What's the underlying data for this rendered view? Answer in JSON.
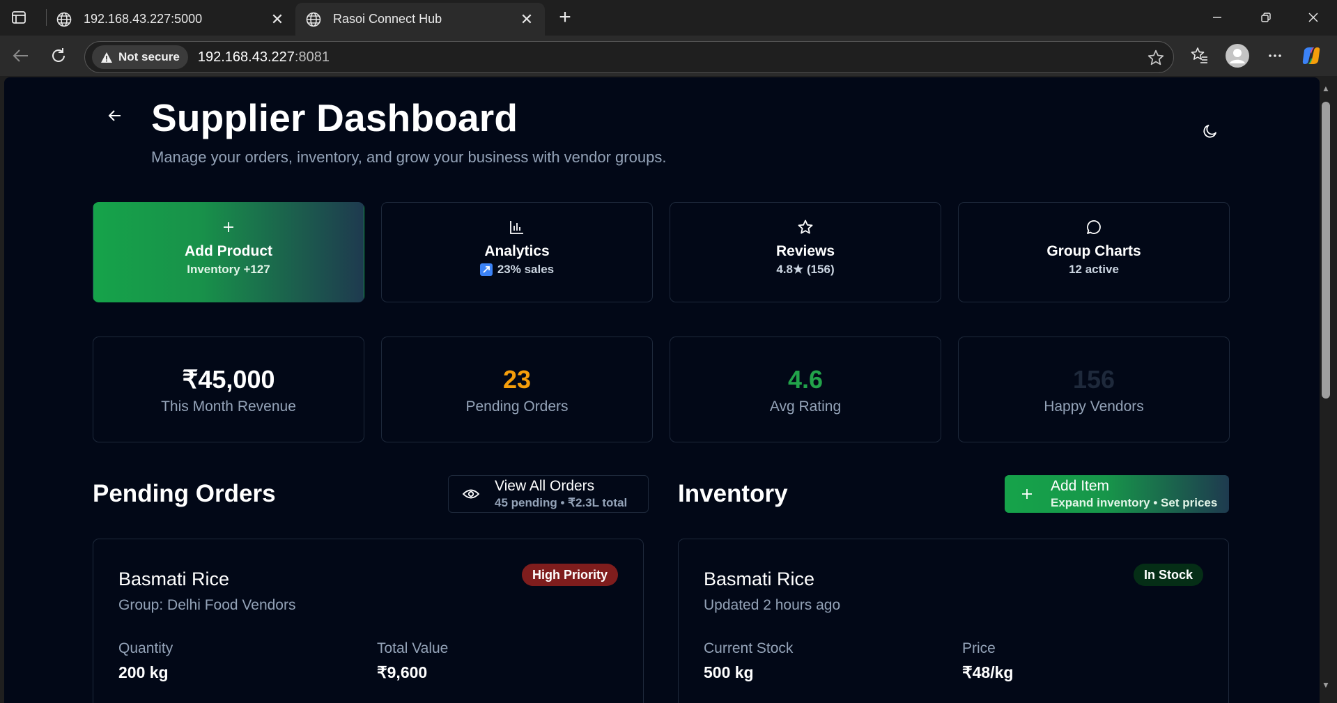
{
  "browser": {
    "tabs": [
      {
        "title": "192.168.43.227:5000",
        "active": false
      },
      {
        "title": "Rasoi Connect Hub",
        "active": true
      }
    ],
    "security_label": "Not secure",
    "url_host": "192.168.43.227",
    "url_port": ":8081"
  },
  "header": {
    "title": "Supplier Dashboard",
    "subtitle": "Manage your orders, inventory, and grow your business with vendor groups."
  },
  "quick_actions": [
    {
      "title": "Add Product",
      "subtitle": "Inventory +127",
      "icon": "plus-icon"
    },
    {
      "title": "Analytics",
      "subtitle": "23% sales",
      "icon": "bar-chart-icon"
    },
    {
      "title": "Reviews",
      "subtitle": "4.8★ (156)",
      "icon": "star-icon"
    },
    {
      "title": "Group Charts",
      "subtitle": "12 active",
      "icon": "message-circle-icon"
    }
  ],
  "stats": [
    {
      "value": "₹45,000",
      "label": "This Month Revenue",
      "color": "#ffffff"
    },
    {
      "value": "23",
      "label": "Pending Orders",
      "color": "#f59e0b"
    },
    {
      "value": "4.6",
      "label": "Avg Rating",
      "color": "#22a34a"
    },
    {
      "value": "156",
      "label": "Happy Vendors",
      "color": "#1e293b"
    }
  ],
  "pending_orders": {
    "title": "Pending Orders",
    "view_all_label": "View All Orders",
    "view_all_sub": "45 pending • ₹2.3L total",
    "items": [
      {
        "name": "Basmati Rice",
        "group": "Group: Delhi Food Vendors",
        "badge": "High Priority",
        "quantity_label": "Quantity",
        "quantity": "200 kg",
        "total_label": "Total Value",
        "total": "₹9,600"
      }
    ]
  },
  "inventory": {
    "title": "Inventory",
    "add_label": "Add Item",
    "add_sub": "Expand inventory • Set prices",
    "items": [
      {
        "name": "Basmati Rice",
        "updated": "Updated 2 hours ago",
        "badge": "In Stock",
        "stock_label": "Current Stock",
        "stock": "500 kg",
        "price_label": "Price",
        "price": "₹48/kg"
      }
    ]
  },
  "colors": {
    "accent_green": "#16a34a",
    "page_bg": "#020817",
    "high_priority_bg": "#7f1d1d",
    "in_stock_bg": "#052e16"
  }
}
